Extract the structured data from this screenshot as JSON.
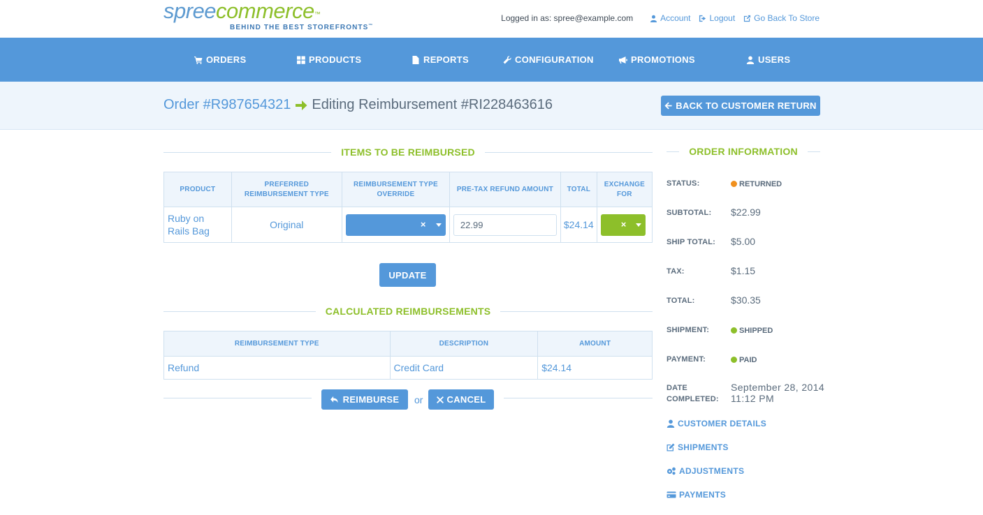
{
  "brand": {
    "name_part1": "spree",
    "name_part2": "commerce",
    "trademark": "™",
    "tagline": "BEHIND THE BEST STOREFRONTS",
    "tagline_tm": "™"
  },
  "userbar": {
    "logged_in_text": "Logged in as: spree@example.com",
    "account_label": "Account",
    "logout_label": "Logout",
    "store_label": "Go Back To Store"
  },
  "nav": {
    "orders": "ORDERS",
    "products": "PRODUCTS",
    "reports": "REPORTS",
    "configuration": "CONFIGURATION",
    "promotions": "PROMOTIONS",
    "users": "USERS"
  },
  "page": {
    "order_link": "Order #R987654321",
    "editing_text": "Editing Reimbursement #RI228463616",
    "back_button": "BACK TO CUSTOMER RETURN"
  },
  "items": {
    "heading": "ITEMS TO BE REIMBURSED",
    "headers": {
      "product": "PRODUCT",
      "preferred": "PREFERRED REIMBURSEMENT TYPE",
      "override": "REIMBURSEMENT TYPE OVERRIDE",
      "pretax": "PRE-TAX REFUND AMOUNT",
      "total": "TOTAL",
      "exchange": "EXCHANGE FOR"
    },
    "row": {
      "product": "Ruby on Rails Bag",
      "preferred": "Original",
      "override_clear": "×",
      "pretax_value": "22.99",
      "total": "$24.14",
      "exchange_clear": "×"
    },
    "update_button": "UPDATE"
  },
  "calculated": {
    "heading": "CALCULATED REIMBURSEMENTS",
    "headers": {
      "type": "REIMBURSEMENT TYPE",
      "description": "DESCRIPTION",
      "amount": "AMOUNT"
    },
    "row": {
      "type": "Refund",
      "description": "Credit Card",
      "amount": "$24.14"
    },
    "reimburse_button": "REIMBURSE",
    "or_text": "or",
    "cancel_button": "CANCEL"
  },
  "order_info": {
    "heading": "ORDER INFORMATION",
    "status_label": "STATUS:",
    "status_value": "RETURNED",
    "subtotal_label": "SUBTOTAL:",
    "subtotal_value": "$22.99",
    "ship_total_label": "SHIP TOTAL:",
    "ship_total_value": "$5.00",
    "tax_label": "TAX:",
    "tax_value": "$1.15",
    "total_label": "TOTAL:",
    "total_value": "$30.35",
    "shipment_label": "SHIPMENT:",
    "shipment_value": "SHIPPED",
    "payment_label": "PAYMENT:",
    "payment_value": "PAID",
    "date_label_1": "DATE",
    "date_label_2": "COMPLETED:",
    "date_value_1": "September 28, 2014",
    "date_value_2": "11:12 PM",
    "links": {
      "customer_details": "CUSTOMER DETAILS",
      "shipments": "SHIPMENTS",
      "adjustments": "ADJUSTMENTS",
      "payments": "PAYMENTS"
    }
  },
  "colors": {
    "primary": "#5498da",
    "accent_green": "#8dbf2a",
    "returned_dot": "#f0901e",
    "shipped_dot": "#8dbf2a",
    "paid_dot": "#8dbf2a"
  }
}
